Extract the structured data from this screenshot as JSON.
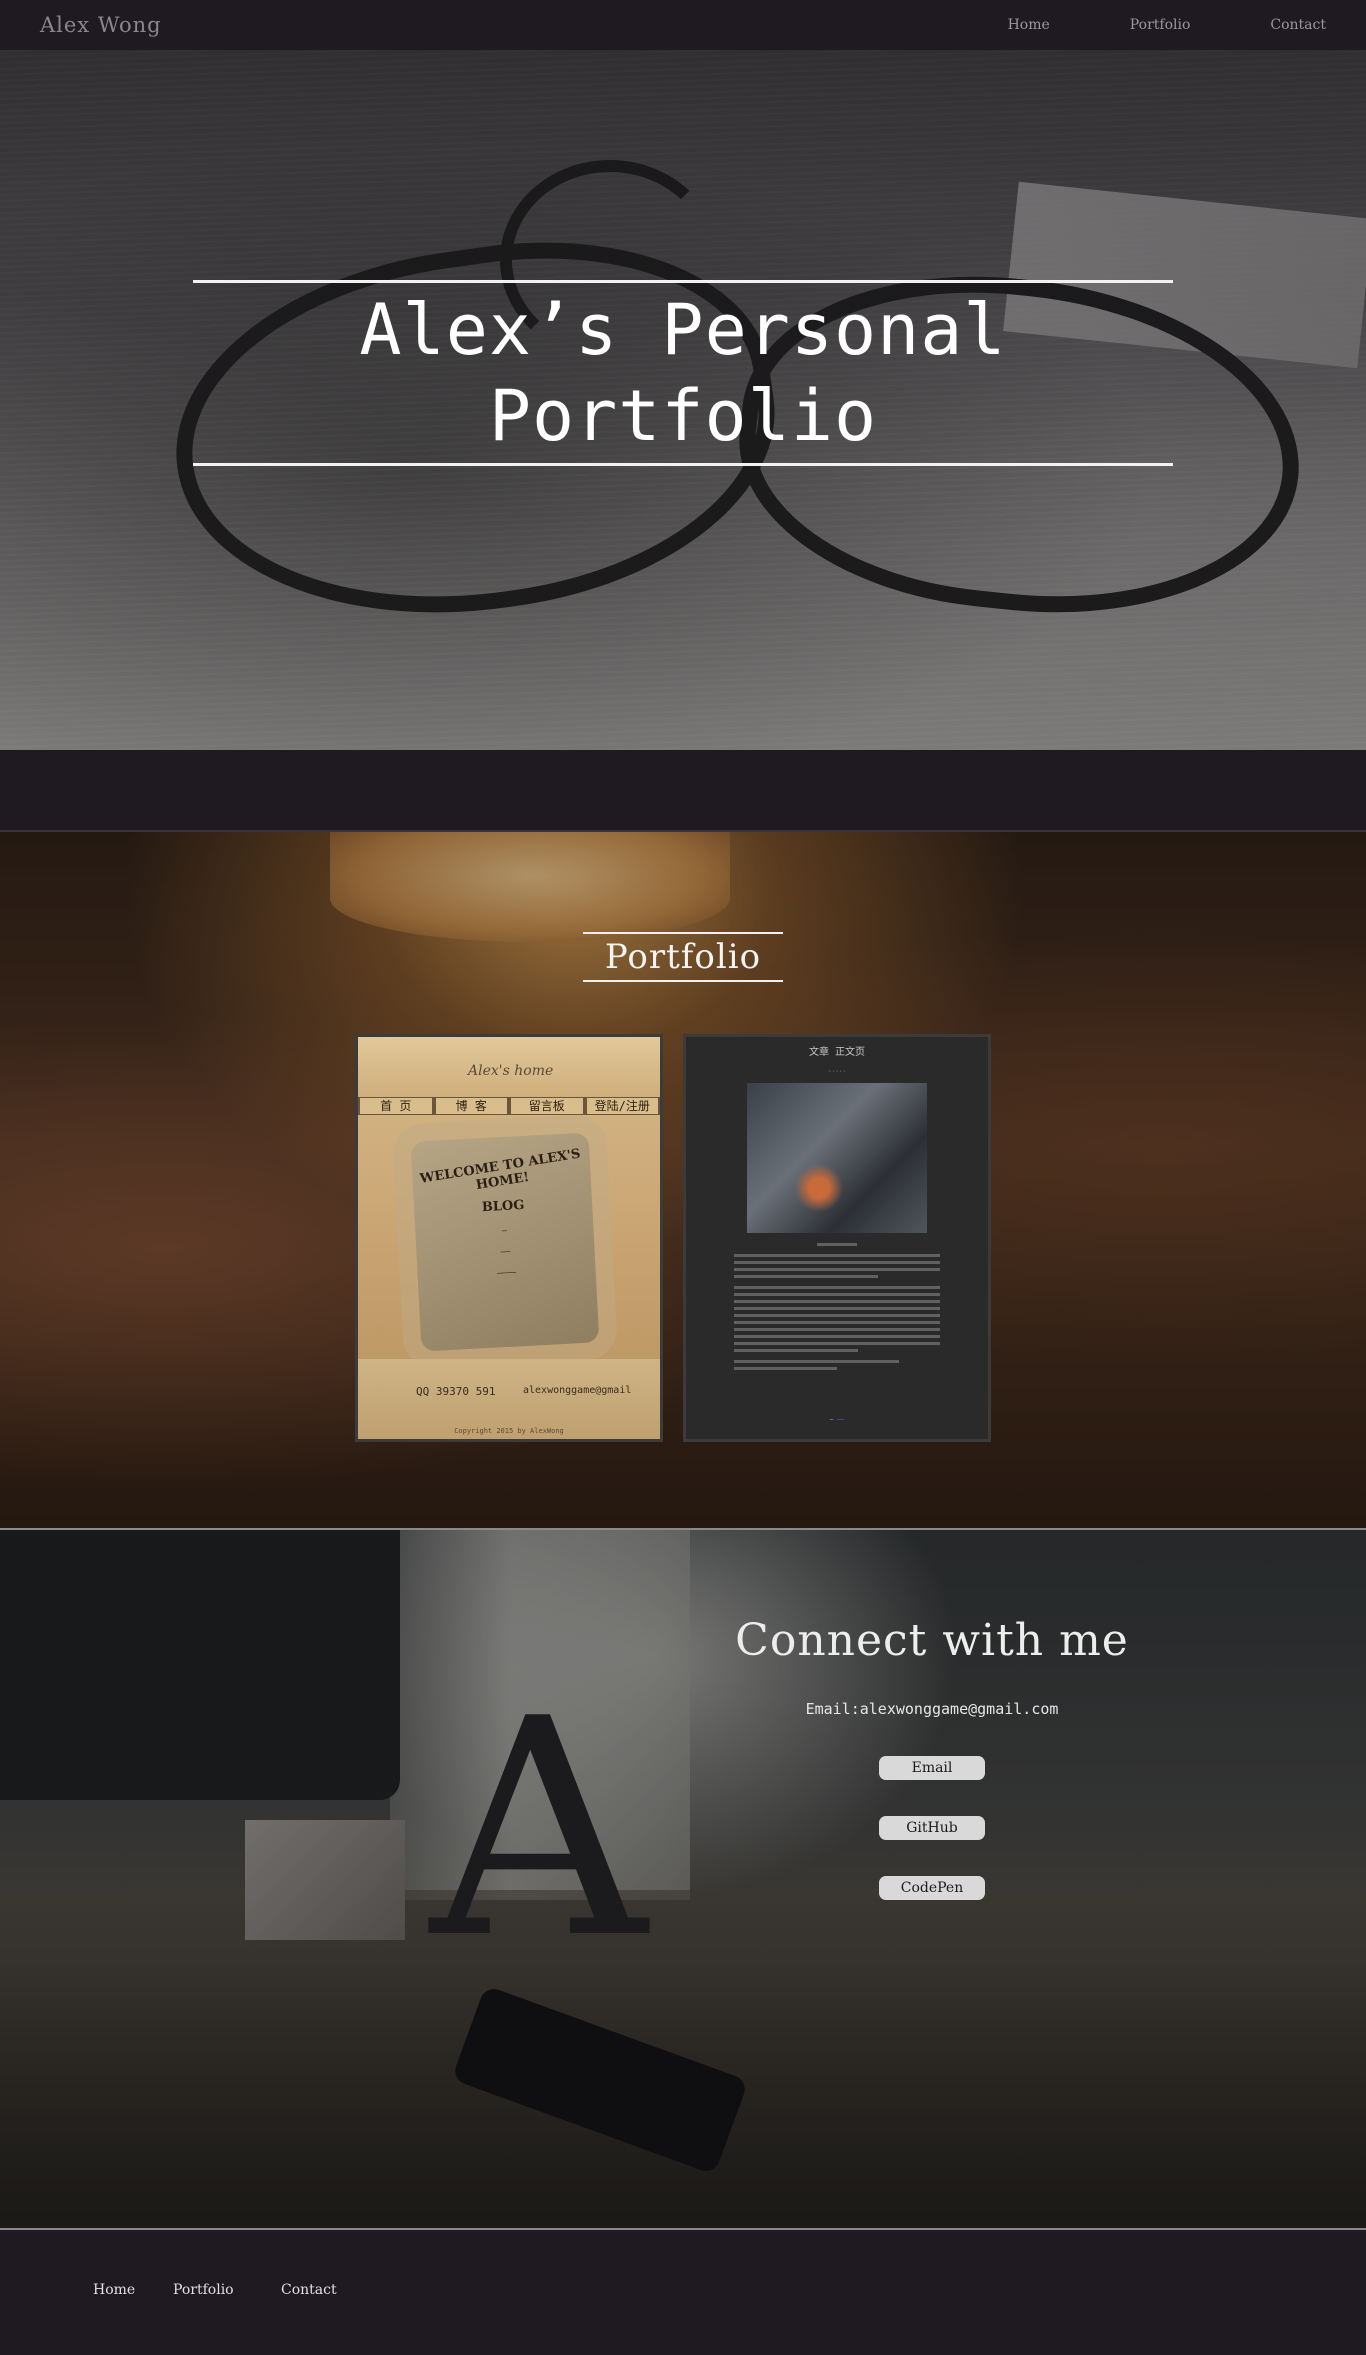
{
  "nav": {
    "brand": "Alex Wong",
    "links": [
      "Home",
      "Portfolio",
      "Contact"
    ]
  },
  "hero": {
    "title_line1": "Alex’s Personal",
    "title_line2": "Portfolio"
  },
  "portfolio": {
    "title": "Portfolio",
    "project1": {
      "brand": "Alex's home",
      "menu": [
        "首 页",
        "博 客",
        "留言板",
        "登陆/注册"
      ],
      "welcome": "WELCOME TO ALEX'S HOME!",
      "blog": "BLOG",
      "qq": "QQ 39370 591",
      "mail": "alexwonggame@gmail",
      "copyright": "Copyright 2015 by AlexWong"
    },
    "project2": {
      "title": "文章 正文页"
    }
  },
  "contact": {
    "title": "Connect with me",
    "email_text": "Email:alexwonggame@gmail.com",
    "buttons": [
      "Email",
      "GitHub",
      "CodePen"
    ]
  },
  "footer": {
    "links": [
      "Home",
      "Portfolio",
      "Contact"
    ]
  }
}
